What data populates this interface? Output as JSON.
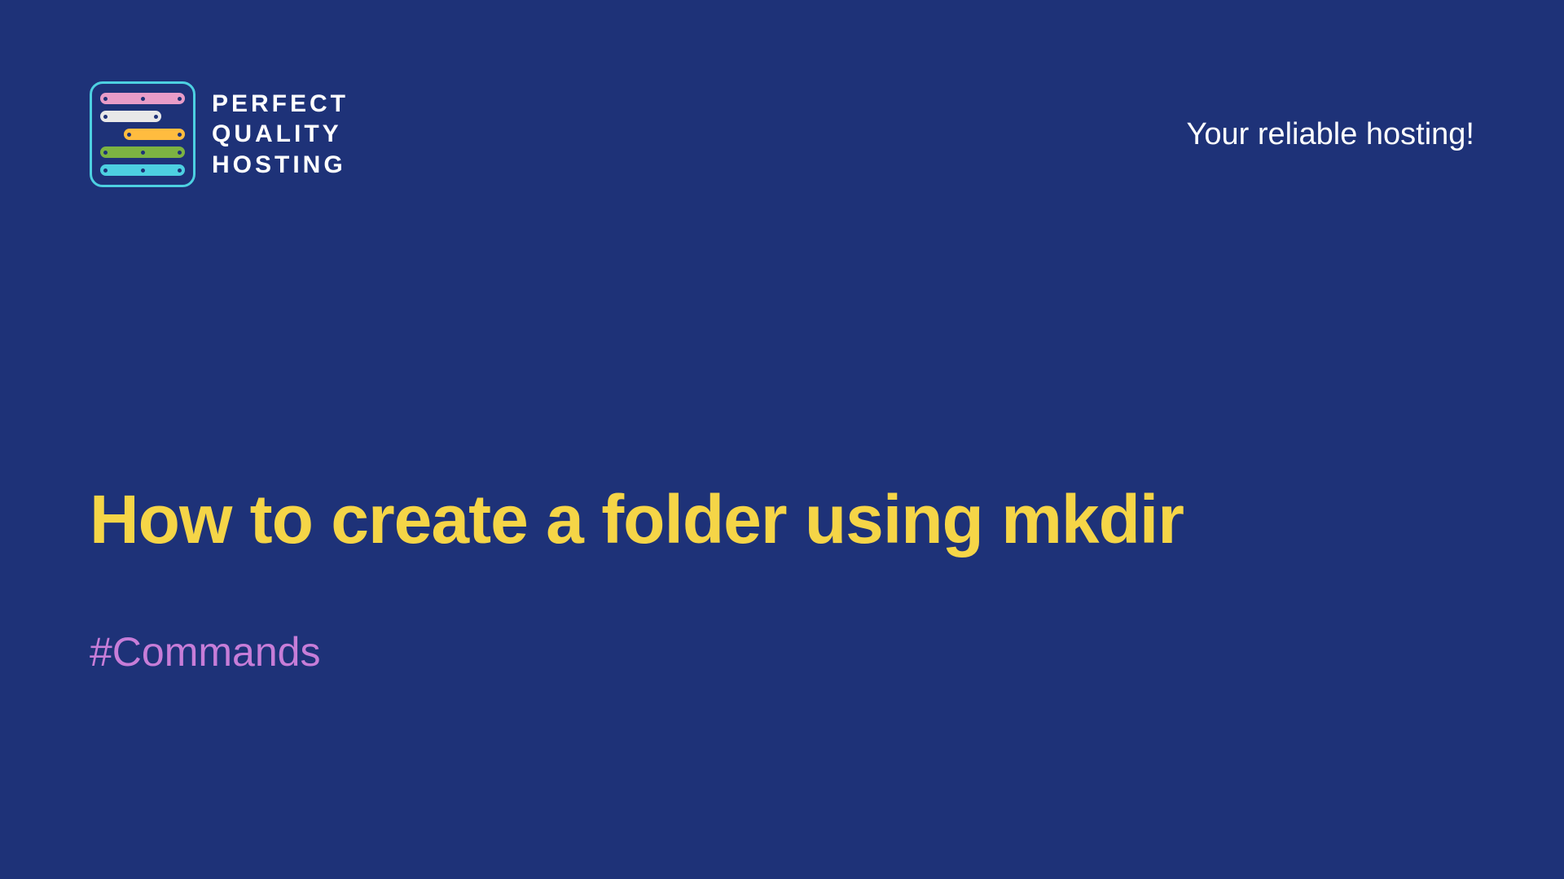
{
  "logo": {
    "line1": "PERFECT",
    "line2": "QUALITY",
    "line3": "HOSTING"
  },
  "tagline": "Your reliable hosting!",
  "title": "How to create a folder using mkdir",
  "category": "#Commands"
}
